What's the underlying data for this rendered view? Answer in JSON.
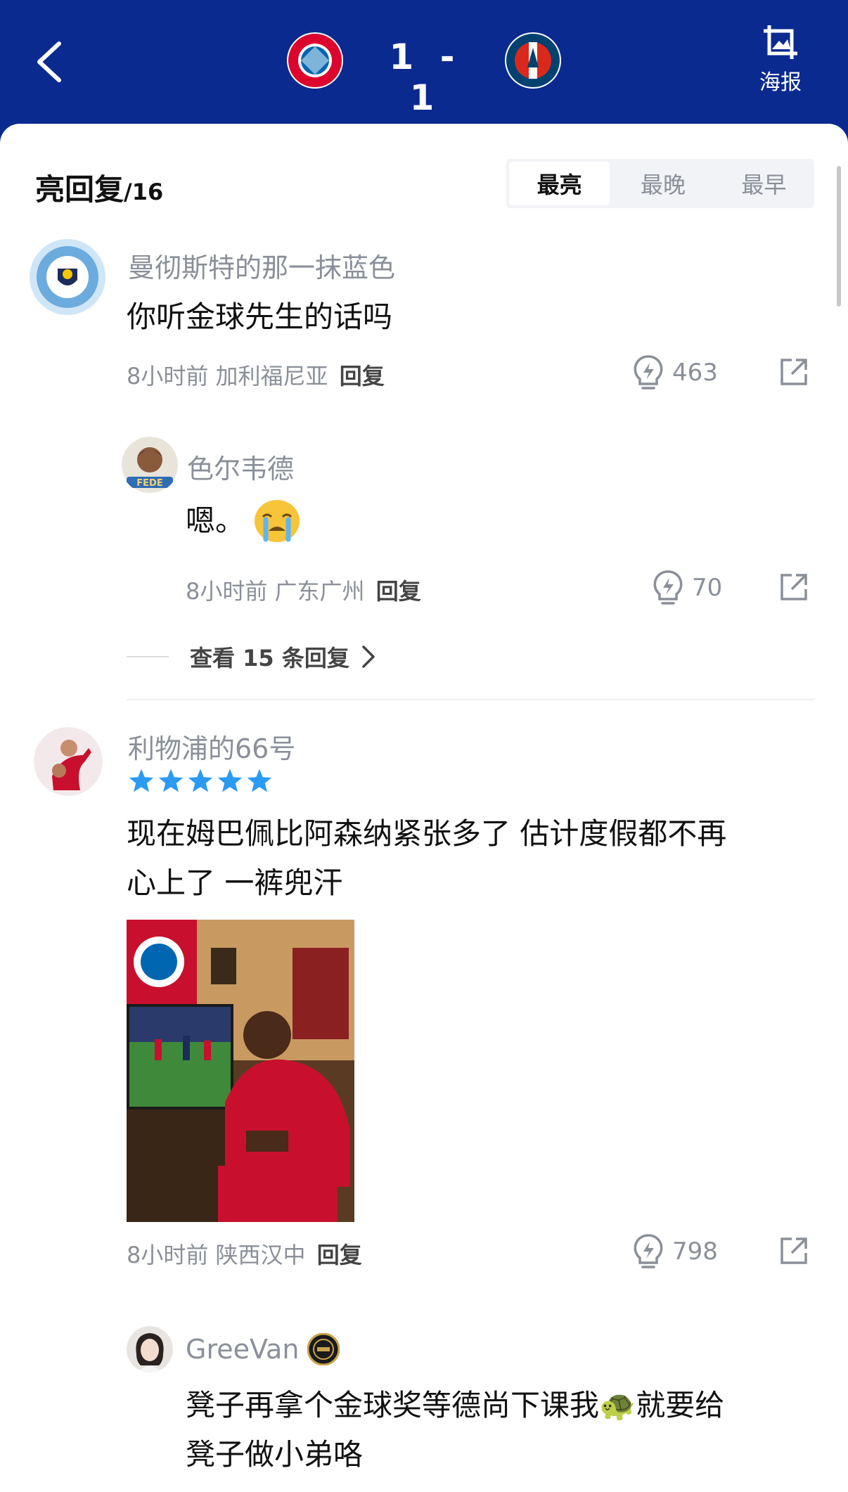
{
  "header": {
    "score": "1 - 1",
    "home_team": "FC Bayern München",
    "away_team": "Paris Saint-Germain",
    "poster_label": "海报"
  },
  "section": {
    "title": "亮回复",
    "count": "/16",
    "sort_tabs": [
      "最亮",
      "最晚",
      "最早"
    ]
  },
  "comments": [
    {
      "username": "曼彻斯特的那一抹蓝色",
      "content": "你听金球先生的话吗",
      "time": "8小时前",
      "location": "加利福尼亚",
      "reply": "回复",
      "lights": "463"
    },
    {
      "username": "色尔韦德",
      "content": "嗯。",
      "time": "8小时前",
      "location": "广东广州",
      "reply": "回复",
      "lights": "70"
    },
    {
      "view_more": "查看 15 条回复"
    },
    {
      "username": "利物浦的66号",
      "content_line1": "现在姆巴佩比阿森纳紧张多了 估计度假都不再",
      "content_line2": "心上了 一裤兜汗",
      "time": "8小时前",
      "location": "陕西汉中",
      "reply": "回复",
      "lights": "798"
    },
    {
      "username": "GreeVan",
      "content_line1": "凳子再拿个金球奖等德尚下课我🐢就要给",
      "content_line2": "凳子做小弟咯"
    }
  ],
  "colors": {
    "header_bg": "#0b2a8f",
    "star": "#2b9af3",
    "muted": "#8a8f99"
  }
}
